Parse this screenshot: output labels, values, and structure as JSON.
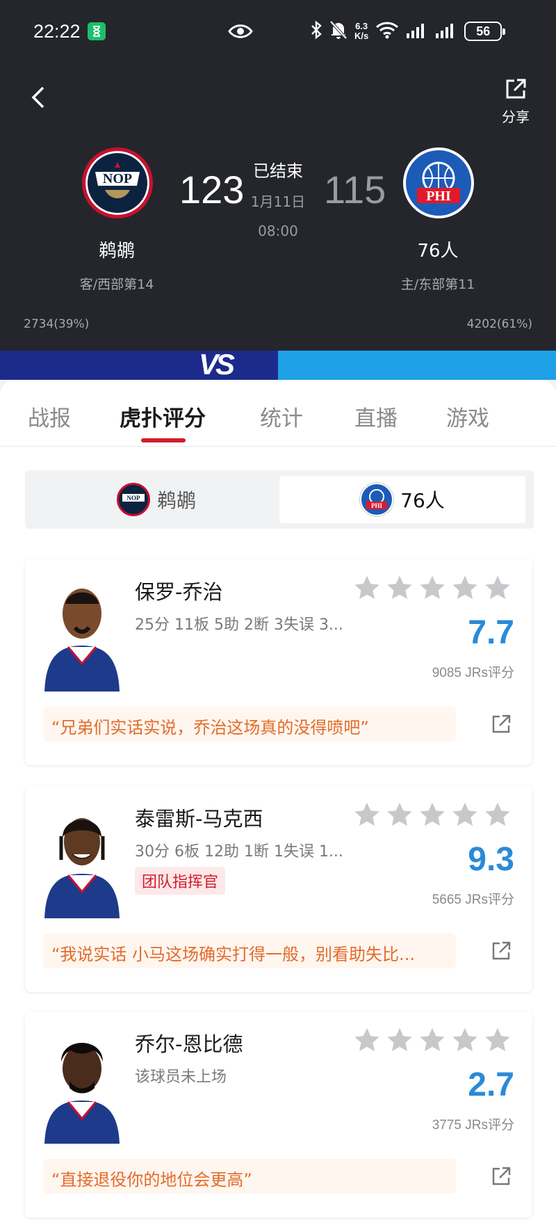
{
  "status_bar": {
    "time": "22:22",
    "net_speed_value": "6.3",
    "net_speed_unit": "K/s",
    "battery": "56",
    "icons": [
      "hourglass-icon",
      "eye-icon",
      "bluetooth-icon",
      "mute-bell-icon",
      "wifi-icon",
      "signal-icon",
      "signal-icon",
      "battery-icon"
    ]
  },
  "header": {
    "share_label": "分享",
    "game_status": "已结束",
    "game_date": "1月11日",
    "game_time": "08:00",
    "home": {
      "name": "鹈鹕",
      "score": "123",
      "rank": "客/西部第14",
      "support": "2734(39%)",
      "logo_text": "NOP"
    },
    "away": {
      "name": "76人",
      "score": "115",
      "rank": "主/东部第11",
      "support": "4202(61%)",
      "logo_text": "PHI"
    },
    "vs_text": "VS",
    "colors": {
      "bg": "#24262c",
      "vs_left": "#1c2a8c",
      "vs_right": "#1ea0e6"
    }
  },
  "tabs": [
    {
      "label": "战报",
      "active": false
    },
    {
      "label": "虎扑评分",
      "active": true
    },
    {
      "label": "统计",
      "active": false
    },
    {
      "label": "直播",
      "active": false
    },
    {
      "label": "游戏",
      "active": false
    }
  ],
  "team_switch": {
    "left": {
      "name": "鹈鹕",
      "logo_text": "NOP"
    },
    "right": {
      "name": "76人",
      "logo_text": "PHI",
      "selected": true
    }
  },
  "players": [
    {
      "name": "保罗-乔治",
      "stats": "25分 11板 5助 2断 3失误 3...",
      "tag": "",
      "rating": "7.7",
      "votes": "9085 JRs评分",
      "quote": "“兄弟们实话实说，乔治这场真的没得喷吧”"
    },
    {
      "name": "泰雷斯-马克西",
      "stats": "30分 6板 12助 1断 1失误 1...",
      "tag": "团队指挥官",
      "rating": "9.3",
      "votes": "5665 JRs评分",
      "quote": "“我说实话 小马这场确实打得一般，别看助失比..."
    },
    {
      "name": "乔尔-恩比德",
      "stats": "该球员未上场",
      "tag": "",
      "rating": "2.7",
      "votes": "3775 JRs评分",
      "quote": "“直接退役你的地位会更高”"
    }
  ],
  "colors": {
    "accent_red": "#d21e2b",
    "rating_blue": "#2a8ad8",
    "quote_orange": "#e36b2b",
    "star_gray": "#c8c8cc"
  }
}
